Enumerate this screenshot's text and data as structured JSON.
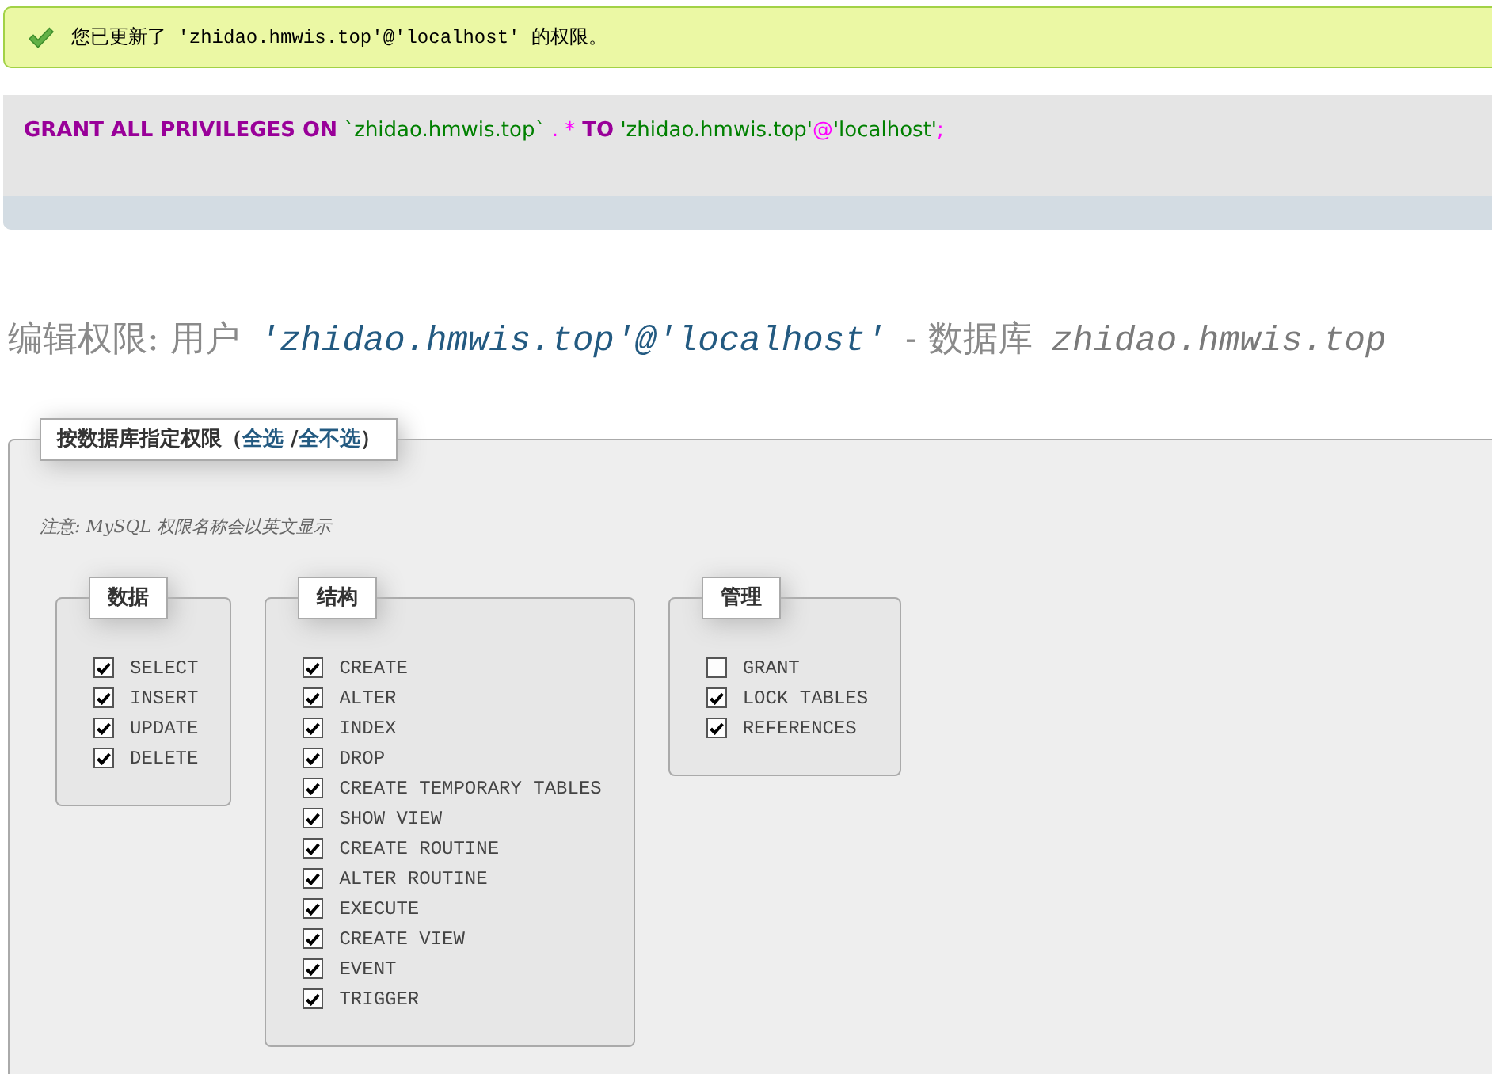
{
  "notice": {
    "text": "您已更新了 'zhidao.hmwis.top'@'localhost' 的权限。"
  },
  "query": {
    "tokens": [
      {
        "kind": "keyword",
        "text": "GRANT ALL PRIVILEGES ON"
      },
      {
        "kind": "string",
        "text": " `zhidao.hmwis.top`"
      },
      {
        "kind": "operator",
        "text": " ."
      },
      {
        "kind": "operator",
        "text": " *"
      },
      {
        "kind": "keyword",
        "text": " TO"
      },
      {
        "kind": "string",
        "text": " 'zhidao.hmwis.top'"
      },
      {
        "kind": "operator",
        "text": "@"
      },
      {
        "kind": "string",
        "text": "'localhost'"
      },
      {
        "kind": "operator",
        "text": ";"
      }
    ]
  },
  "heading": {
    "label": "编辑权限: 用户",
    "user": "'zhidao.hmwis.top'@'localhost'",
    "separator": "- 数据库",
    "database": "zhidao.hmwis.top"
  },
  "privileges": {
    "legend": [
      {
        "kind": "text",
        "text": "按数据库指定权限（"
      },
      {
        "kind": "link",
        "text": "全选"
      },
      {
        "kind": "text",
        "text": " /"
      },
      {
        "kind": "link",
        "text": "全不选"
      },
      {
        "kind": "text",
        "text": "）"
      }
    ],
    "note": "注意: MySQL 权限名称会以英文显示",
    "groups": [
      {
        "title": "数据",
        "items": [
          {
            "name": "SELECT",
            "checked": true
          },
          {
            "name": "INSERT",
            "checked": true
          },
          {
            "name": "UPDATE",
            "checked": true
          },
          {
            "name": "DELETE",
            "checked": true
          }
        ]
      },
      {
        "title": "结构",
        "items": [
          {
            "name": "CREATE",
            "checked": true
          },
          {
            "name": "ALTER",
            "checked": true
          },
          {
            "name": "INDEX",
            "checked": true
          },
          {
            "name": "DROP",
            "checked": true
          },
          {
            "name": "CREATE TEMPORARY TABLES",
            "checked": true
          },
          {
            "name": "SHOW VIEW",
            "checked": true
          },
          {
            "name": "CREATE ROUTINE",
            "checked": true
          },
          {
            "name": "ALTER ROUTINE",
            "checked": true
          },
          {
            "name": "EXECUTE",
            "checked": true
          },
          {
            "name": "CREATE VIEW",
            "checked": true
          },
          {
            "name": "EVENT",
            "checked": true
          },
          {
            "name": "TRIGGER",
            "checked": true
          }
        ]
      },
      {
        "title": "管理",
        "items": [
          {
            "name": "GRANT",
            "checked": false
          },
          {
            "name": "LOCK TABLES",
            "checked": true
          },
          {
            "name": "REFERENCES",
            "checked": true
          }
        ]
      }
    ]
  }
}
